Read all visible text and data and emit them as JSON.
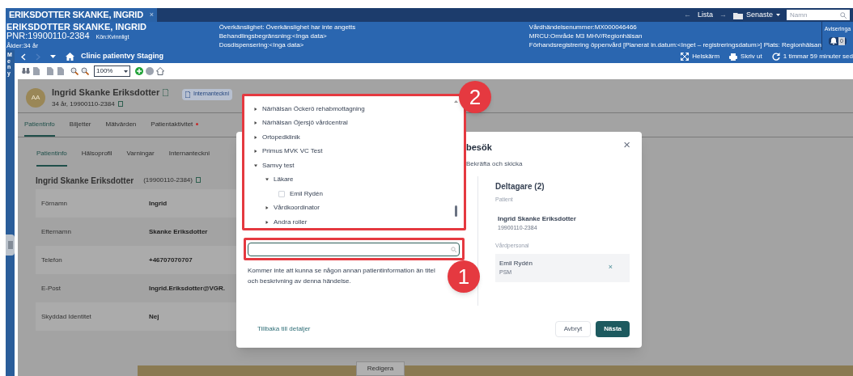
{
  "window_tab": {
    "title": "ERIKSDOTTER SKANKE, INGRID",
    "close": "×"
  },
  "top_nav": {
    "back": "←",
    "list": "Lista",
    "forward": "→",
    "recent": "Senaste",
    "search": {
      "placeholder": "Namn"
    }
  },
  "patient_banner": {
    "name": "ERIKSDOTTER SKANKE, INGRID",
    "pnr": "PNR:19900110-2384",
    "gender": "Kön:Kvinnligt",
    "age": "Ålder:34 år",
    "info_1": [
      "Överkänslighet: Överkänslighet har inte angetts",
      "Behandlingsbegränsning:<Inga data>",
      "Dosdispensering:<Inga data>"
    ],
    "info_2": [
      "Vårdhändelsenummer:MX000046466",
      "MRCU:Område M3 MHV/Regionhälsan",
      "Förhandsregistrering öppenvård [Planerat in.datum:<Inget – registreringsdatum>] Plats: Regionhälsan"
    ],
    "notifications": {
      "label": "Aviseringa",
      "count": "0"
    }
  },
  "menu_label": "Meny",
  "breadcrumb": {
    "title": "Clinic patientvy Staging",
    "fullscreen": "Helskärm",
    "print": "Skriv ut",
    "refresh": "1 timmar 59 minuter sed"
  },
  "toolbar": {
    "zoom": "100%"
  },
  "patient_card": {
    "initials": "AA",
    "name": "Ingrid Skanke Eriksdotter",
    "details": "34 år, 19900110-2384",
    "note_button": "Internanteckni"
  },
  "tabs": [
    {
      "label": "Patientinfo",
      "selected": true,
      "alert": false
    },
    {
      "label": "Biljetter",
      "selected": false,
      "alert": false
    },
    {
      "label": "Mätvärden",
      "selected": false,
      "alert": false
    },
    {
      "label": "Patientaktivitet",
      "selected": false,
      "alert": true
    }
  ],
  "subtabs": [
    {
      "label": "Patientinfo",
      "selected": true
    },
    {
      "label": "Hälsoprofil",
      "selected": false
    },
    {
      "label": "Varningar",
      "selected": false
    },
    {
      "label": "Internanteckni",
      "selected": false
    }
  ],
  "patient_info": {
    "heading": "Ingrid Skanke Eriksdotter",
    "pnr": "(19900110-2384)",
    "rows": [
      {
        "label": "Förnamn",
        "value": "Ingrid"
      },
      {
        "label": "Efternamn",
        "value": "Skanke Eriksdotter"
      },
      {
        "label": "Telefon",
        "value": "+46707070707"
      },
      {
        "label": "E-Post",
        "value": "Ingrid.Eriksdotter@VGR."
      },
      {
        "label": "Skyddad Identitet",
        "value": "Nej"
      }
    ]
  },
  "edit_button": "Redigera",
  "dialog": {
    "title": "besök",
    "step": "Bekräfta och skicka",
    "close": "×",
    "hint": "Kommer inte att kunna se någon annan patientinformation än titel och beskrivning av denna händelse.",
    "back_link": "Tillbaka till detaljer",
    "participants": {
      "heading": "Deltagare (2)",
      "patient_label": "Patient",
      "patient_name": "Ingrid Skanke Eriksdotter",
      "patient_pnr": "19900110-2384",
      "staff_label": "Vårdpersonal",
      "staff": [
        {
          "name": "Emil Rydén",
          "role": "PSM",
          "remove": "×"
        }
      ]
    },
    "buttons": [
      {
        "label": "Avbryt",
        "kind": "secondary"
      },
      {
        "label": "Nästa",
        "kind": "primary"
      }
    ]
  },
  "tree": [
    {
      "label": "Närhälsan Öckerö rehabmottagning",
      "expanded": false
    },
    {
      "label": "Närhälsan Öjersjö vårdcentral",
      "expanded": false
    },
    {
      "label": "Ortopedklinik",
      "expanded": false
    },
    {
      "label": "Primus MVK VC Test",
      "expanded": false
    },
    {
      "label": "Samvy test",
      "expanded": true,
      "children": [
        {
          "label": "Läkare",
          "expanded": true,
          "children": [
            {
              "label": "Emil Rydén",
              "kind": "checkbox",
              "checked": false
            }
          ]
        },
        {
          "label": "Vårdkoordinator",
          "expanded": false
        },
        {
          "label": "Andra roller",
          "expanded": false
        }
      ]
    }
  ],
  "annotations": [
    {
      "label": "1",
      "kind": "search"
    },
    {
      "label": "2",
      "kind": "tree"
    }
  ]
}
